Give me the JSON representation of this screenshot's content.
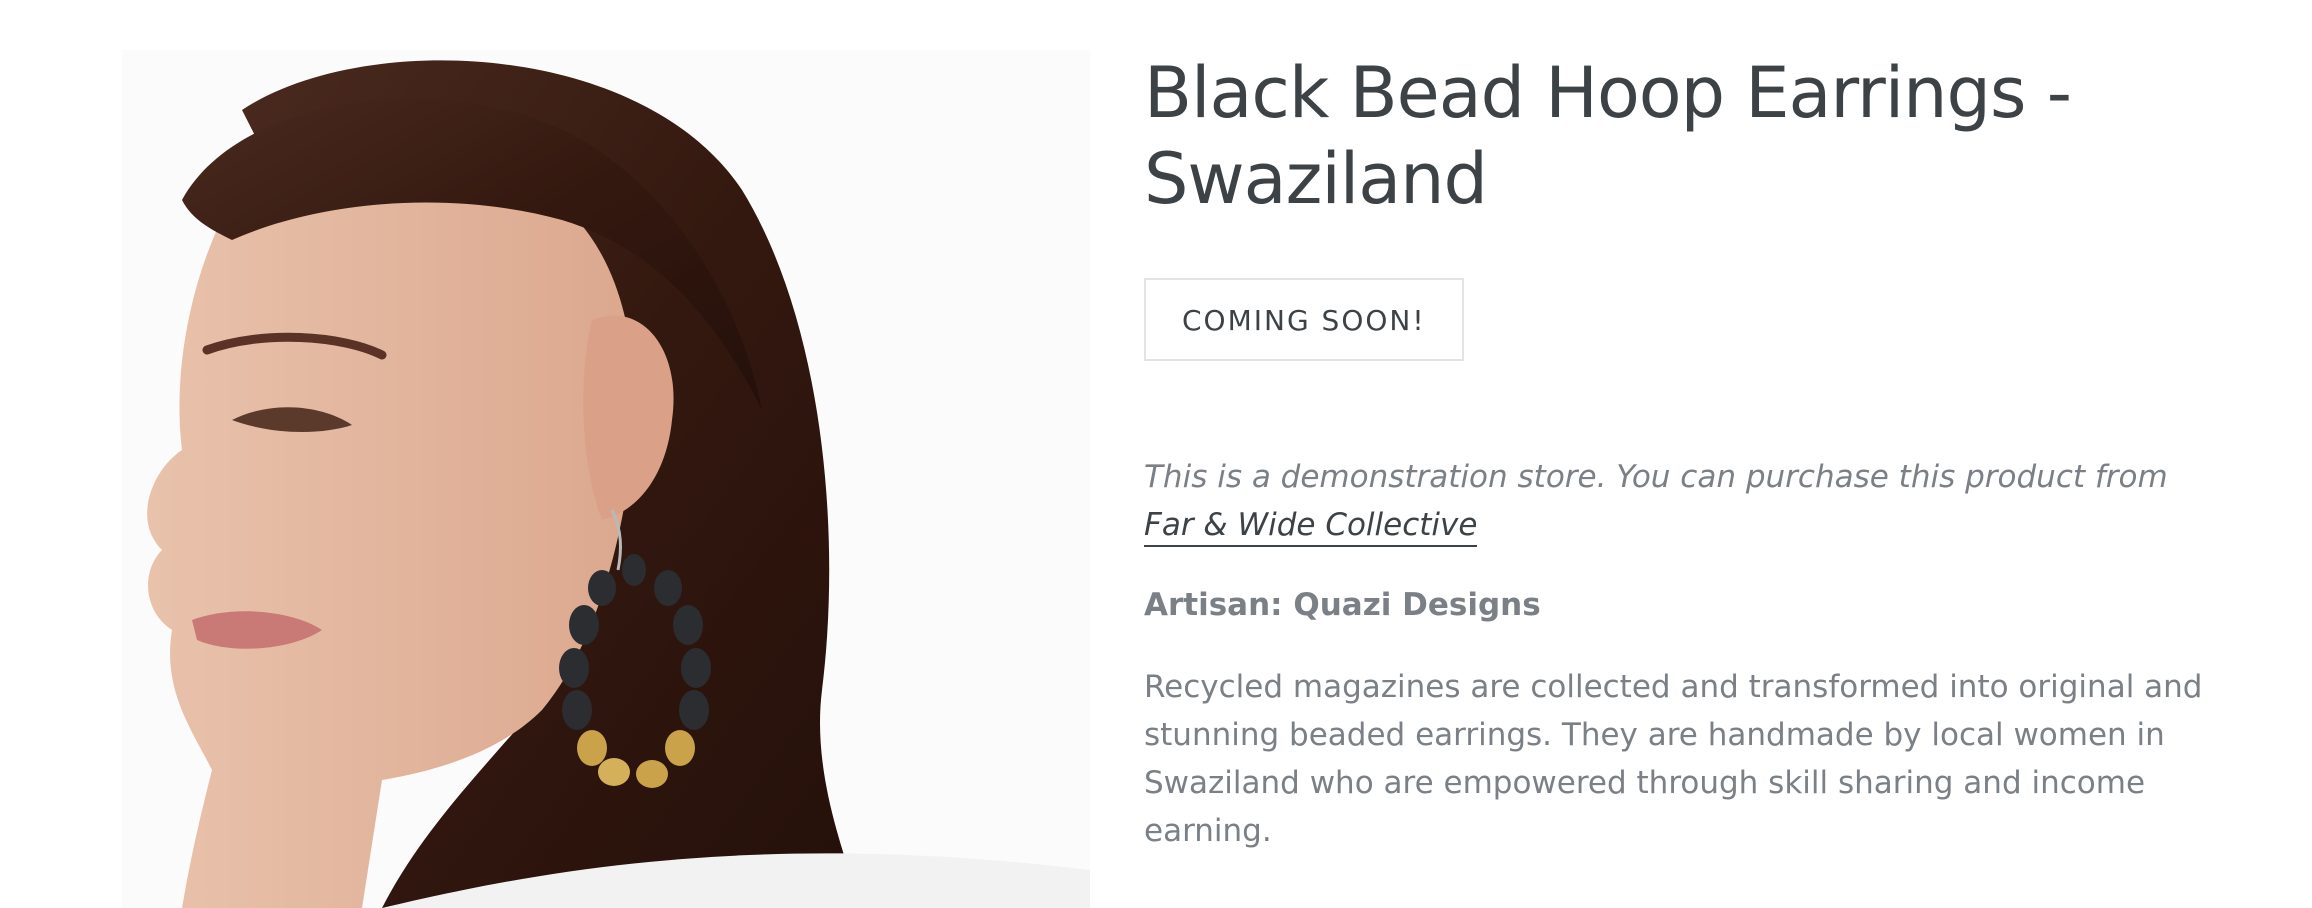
{
  "product": {
    "image_alt": "Model wearing black bead hoop earrings",
    "title": "Black Bead Hoop Earrings - Swaziland",
    "button_label": "COMING SOON!",
    "demo_note_text": "This is a demonstration store. You can purchase this product from ",
    "demo_note_link": "Far & Wide Collective",
    "artisan": "Artisan: Quazi Designs",
    "description": "Recycled magazines are collected and transformed into original and stunning beaded earrings. They are handmade by local women in Swaziland who are empowered through skill sharing and income earning."
  },
  "colors": {
    "heading": "#3d4246",
    "body_text": "#7a8086",
    "button_border": "#e3e3e3",
    "hair": "#3a2118",
    "skin": "#e8bfa8",
    "bead_black": "#2b2d31",
    "bead_gold": "#c9a24a"
  }
}
